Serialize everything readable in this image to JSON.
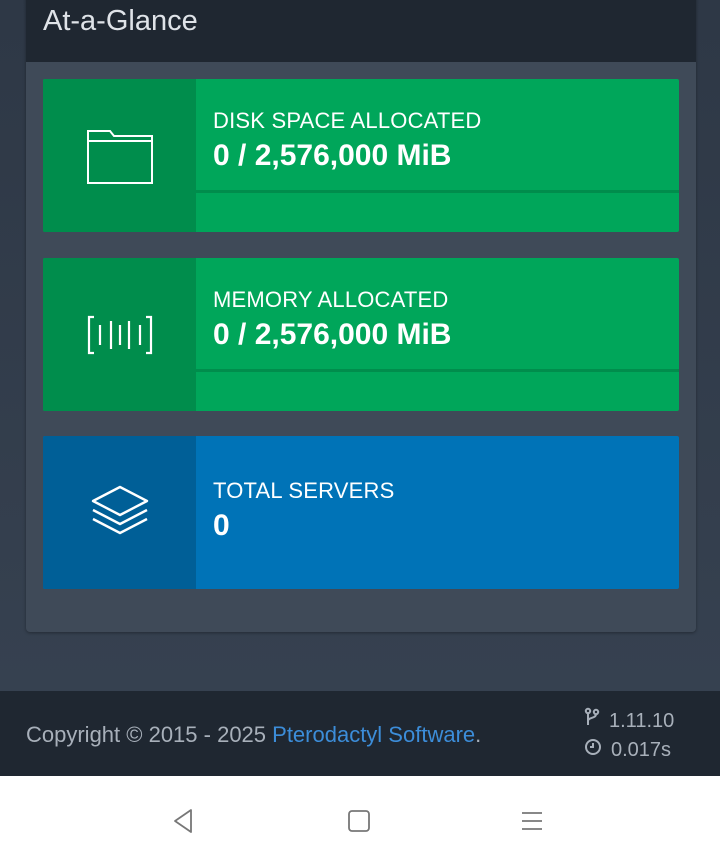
{
  "panel": {
    "title": "At-a-Glance"
  },
  "cards": [
    {
      "label": "DISK SPACE ALLOCATED",
      "value": "0 / 2,576,000 MiB",
      "icon": "folder-icon",
      "color": "#00a65a",
      "progress": 0
    },
    {
      "label": "MEMORY ALLOCATED",
      "value": "0 / 2,576,000 MiB",
      "icon": "memory-icon",
      "color": "#00a65a",
      "progress": 0
    },
    {
      "label": "TOTAL SERVERS",
      "value": "0",
      "icon": "layers-icon",
      "color": "#0073b7"
    }
  ],
  "footer": {
    "copyright_prefix": "Copyright © 2015 - 2025 ",
    "company_link": "Pterodactyl Software",
    "copyright_suffix": ".",
    "version": "1.11.10",
    "render_time": "0.017s"
  },
  "android_nav": {
    "back": "back-icon",
    "home": "home-icon",
    "menu": "menu-icon"
  }
}
